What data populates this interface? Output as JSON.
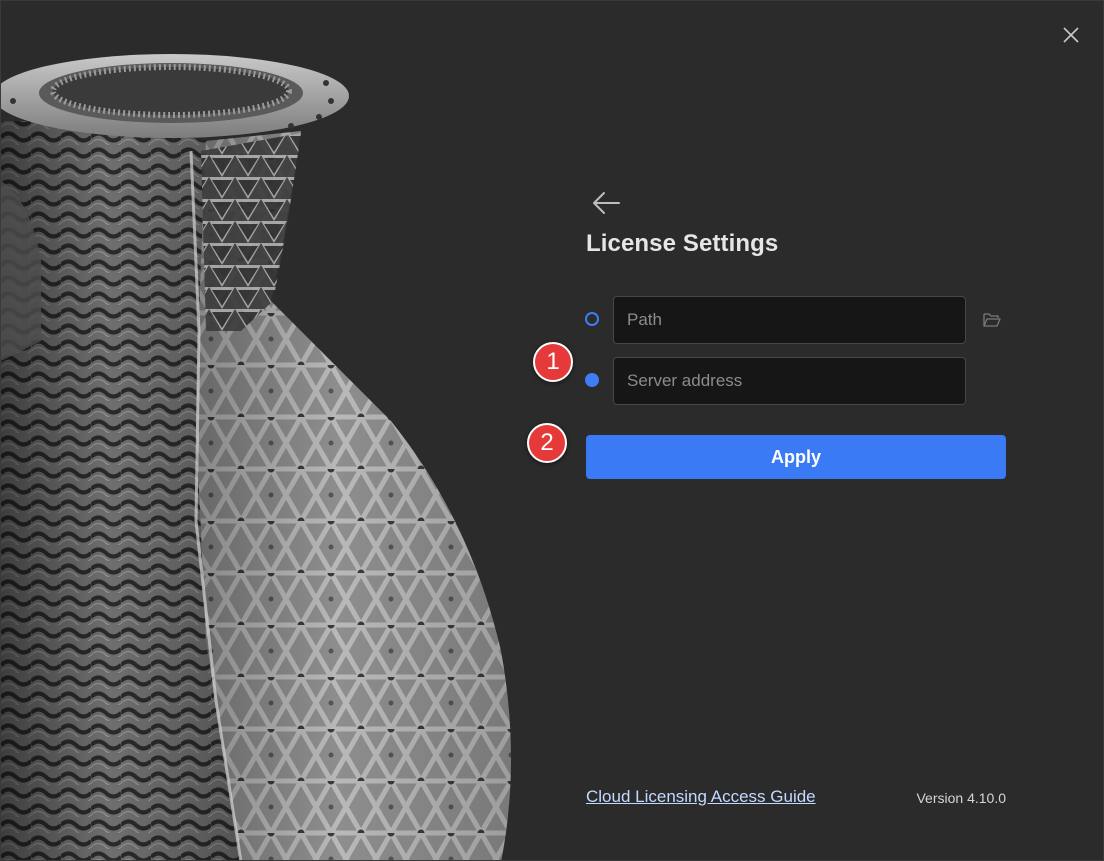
{
  "window": {
    "close_icon": "close-icon"
  },
  "header": {
    "back_icon": "arrow-left-icon",
    "title": "License Settings"
  },
  "license_form": {
    "options": [
      {
        "type": "path",
        "selected": false,
        "placeholder": "Path",
        "value": ""
      },
      {
        "type": "server",
        "selected": true,
        "placeholder": "Server address",
        "value": ""
      }
    ],
    "browse_icon": "folder-open-icon",
    "apply_label": "Apply"
  },
  "annotations": {
    "step1": "1",
    "step2": "2"
  },
  "footer": {
    "guide_link": "Cloud Licensing Access Guide",
    "version": "Version 4.10.0"
  },
  "colors": {
    "background": "#2b2b2b",
    "accent": "#3a7bf5",
    "marker": "#e63a3a",
    "link": "#c3d9ff"
  }
}
